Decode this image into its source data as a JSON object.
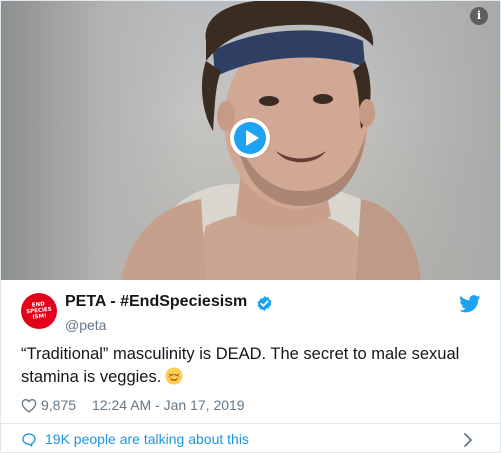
{
  "video": {
    "info_symbol": "i",
    "play_icon": "play-icon"
  },
  "account": {
    "avatar_text": "END SPECIES ISM!",
    "display_name": "PETA - #EndSpeciesism",
    "handle": "@peta",
    "verified_icon": "verified-badge-icon",
    "brand_icon": "twitter-bird-icon",
    "avatar_color": "#e3001b"
  },
  "tweet": {
    "text": "“Traditional” masculinity is DEAD. The secret to male sexual stamina is veggies.",
    "emoji": "relieved-face-icon",
    "likes": "9,875",
    "timestamp": "12:24 AM - Jan 17, 2019"
  },
  "footer": {
    "talking_text": "19K people are talking about this"
  },
  "colors": {
    "twitter_blue": "#1da1f2",
    "link_blue": "#1b95e0",
    "muted": "#657786"
  }
}
